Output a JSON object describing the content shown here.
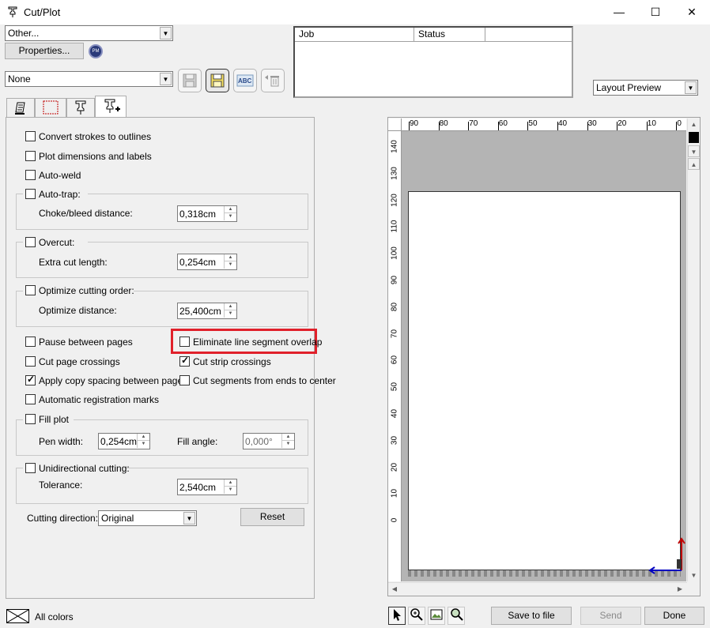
{
  "window": {
    "title": "Cut/Plot",
    "minimize_glyph": "—",
    "maximize_glyph": "☐",
    "close_glyph": "✕"
  },
  "device": {
    "selected": "Other...",
    "properties_label": "Properties...",
    "pm_badge": "PM"
  },
  "preset": {
    "selected": "None",
    "abc_label": "ABC"
  },
  "job_list": {
    "headers": [
      "Job",
      "Status",
      ""
    ]
  },
  "preview_mode": {
    "selected": "Layout Preview"
  },
  "tabs": [
    {
      "icon": "general-tab-icon"
    },
    {
      "icon": "layout-tab-icon"
    },
    {
      "icon": "plotter-tab-icon"
    },
    {
      "icon": "cut-options-tab-icon"
    }
  ],
  "options": {
    "convert_strokes": {
      "label": "Convert strokes to outlines",
      "checked": false
    },
    "plot_dimensions": {
      "label": "Plot dimensions and labels",
      "checked": false
    },
    "auto_weld": {
      "label": "Auto-weld",
      "checked": false
    },
    "auto_trap": {
      "label": "Auto-trap:",
      "checked": false,
      "field_label": "Choke/bleed distance:",
      "value": "0,318cm"
    },
    "overcut": {
      "label": "Overcut:",
      "checked": false,
      "field_label": "Extra cut length:",
      "value": "0,254cm"
    },
    "optimize": {
      "label": "Optimize cutting order:",
      "checked": false,
      "field_label": "Optimize distance:",
      "value": "25,400cm"
    },
    "pause_pages": {
      "label": "Pause between pages",
      "checked": false
    },
    "eliminate_overlap": {
      "label": "Eliminate line segment overlap",
      "checked": false
    },
    "cut_page_crossings": {
      "label": "Cut page crossings",
      "checked": false
    },
    "cut_strip_crossings": {
      "label": "Cut strip crossings",
      "checked": true
    },
    "copy_spacing": {
      "label": "Apply copy spacing between pages",
      "checked": true
    },
    "cut_segments": {
      "label": "Cut segments from ends to center",
      "checked": false
    },
    "registration_marks": {
      "label": "Automatic registration marks",
      "checked": false
    },
    "fill_plot": {
      "label": "Fill plot",
      "checked": false,
      "pen_width_label": "Pen width:",
      "pen_width": "0,254cm",
      "fill_angle_label": "Fill angle:",
      "fill_angle": "0,000°"
    },
    "unidirectional": {
      "label": "Unidirectional cutting:",
      "checked": false,
      "tolerance_label": "Tolerance:",
      "tolerance": "2,540cm"
    },
    "cutting_direction": {
      "label": "Cutting direction:",
      "value": "Original"
    },
    "reset_label": "Reset"
  },
  "ruler": {
    "top_labels": [
      "90",
      "80",
      "70",
      "60",
      "50",
      "40",
      "30",
      "20",
      "10",
      "0"
    ],
    "left_labels": [
      "140",
      "130",
      "120",
      "110",
      "100",
      "90",
      "80",
      "70",
      "60",
      "50",
      "40",
      "30",
      "20",
      "10",
      "0"
    ]
  },
  "bottom": {
    "colors_label": "All colors",
    "save_to_file": "Save to file",
    "send": "Send",
    "done": "Done"
  },
  "colors": {
    "highlight": "#e0202a",
    "page_bg": "#ffffff",
    "canvas_bg": "#b4b4b4",
    "y_axis_arrow": "#c00000",
    "x_axis_arrow": "#0000c0"
  }
}
